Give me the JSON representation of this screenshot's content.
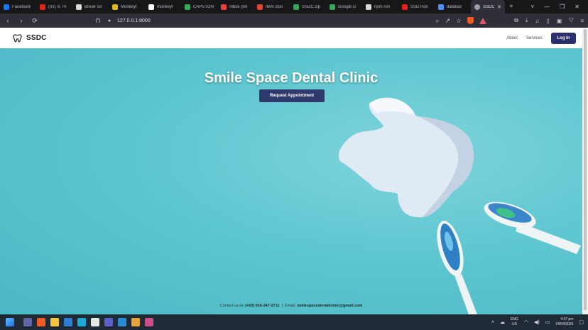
{
  "browser": {
    "tabs": [
      {
        "label": "Facebook",
        "color": "#1877f2"
      },
      {
        "label": "(31) Is Th",
        "color": "#e62117"
      },
      {
        "label": "Break Sil",
        "color": "#d9d9d9"
      },
      {
        "label": "Monkeyt",
        "color": "#e2b714"
      },
      {
        "label": "monkeyt",
        "color": "#ffffff"
      },
      {
        "label": "CAPSTON",
        "color": "#34a853"
      },
      {
        "label": "Inbox (69",
        "color": "#ea4335"
      },
      {
        "label": "Item clon",
        "color": "#ea4335"
      },
      {
        "label": "SSDC.zip",
        "color": "#34a853"
      },
      {
        "label": "Google D",
        "color": "#34a853"
      },
      {
        "label": "npm run",
        "color": "#d9d9d9"
      },
      {
        "label": "SSD Hos",
        "color": "#e62117"
      },
      {
        "label": "databas",
        "color": "#4d90fe"
      }
    ],
    "active_tab": {
      "label": "SSDC",
      "close": "✕"
    },
    "new_tab": "+",
    "window_controls": [
      "˅",
      "—",
      "❐",
      "✕"
    ],
    "url": "127.0.0.1:8000"
  },
  "nav": {
    "brand": "SSDC",
    "links": [
      "About",
      "Services"
    ],
    "login": "Log In"
  },
  "hero": {
    "title": "Smile Space Dental Clinic",
    "cta": "Request Appointment",
    "contact_label": "Contact us at:",
    "phone": "(+63) 916-347-3711",
    "separator": "|",
    "email_label": "Email:",
    "email": "smilespacedentalclinic@gmail.com",
    "background_color": "#5ec6d0"
  },
  "taskbar": {
    "icons": [
      "windows-start",
      "teams",
      "brave",
      "file-explorer",
      "app-blue",
      "edge",
      "notion",
      "teams-2",
      "vscode",
      "app-orange",
      "app-snip"
    ],
    "language": "ENG",
    "region": "US",
    "time": "4:37 pm",
    "date": "24/04/2025"
  }
}
